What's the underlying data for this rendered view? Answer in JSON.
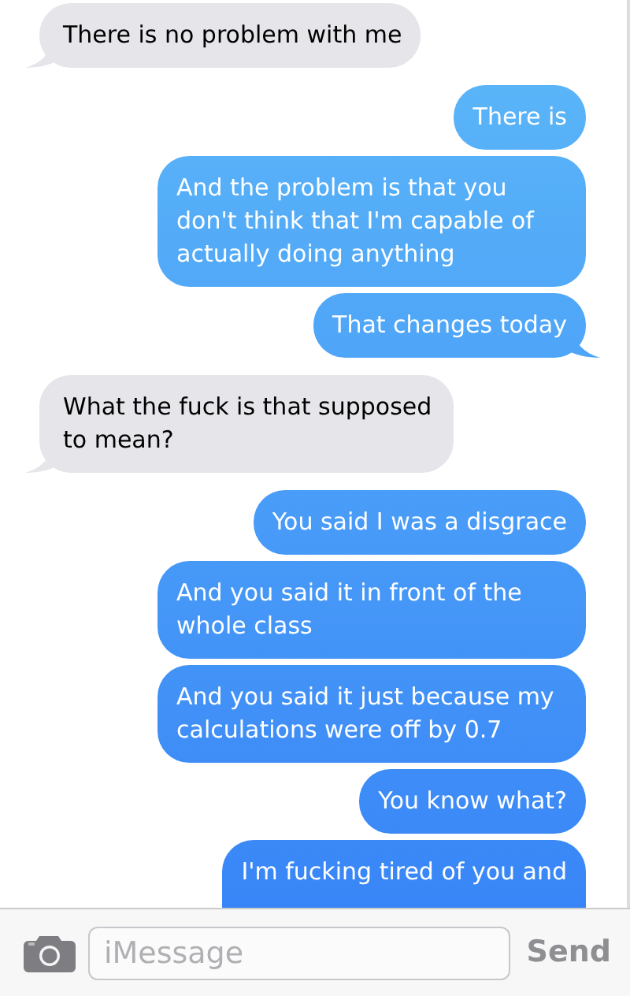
{
  "messages": [
    {
      "kind": "received",
      "text": "There is no problem with me",
      "tail": true
    },
    {
      "kind": "sent",
      "text": "There is",
      "tail": false
    },
    {
      "kind": "sent",
      "text": "And the problem is that you don't think that I'm capable of actually doing anything",
      "tail": false
    },
    {
      "kind": "sent",
      "text": "That changes today",
      "tail": true
    },
    {
      "kind": "received",
      "text": "What the fuck is that supposed to mean?",
      "tail": true
    },
    {
      "kind": "sent",
      "text": "You said I was a disgrace",
      "tail": false
    },
    {
      "kind": "sent",
      "text": "And you said it in front of the whole class",
      "tail": false
    },
    {
      "kind": "sent",
      "text": "And you said it just because my calculations were off by 0.7",
      "tail": false
    },
    {
      "kind": "sent",
      "text": "You know what?",
      "tail": false
    },
    {
      "kind": "sent",
      "text": "I'm fucking tired of you and",
      "tail": false
    }
  ],
  "compose": {
    "placeholder": "iMessage",
    "send": "Send"
  }
}
